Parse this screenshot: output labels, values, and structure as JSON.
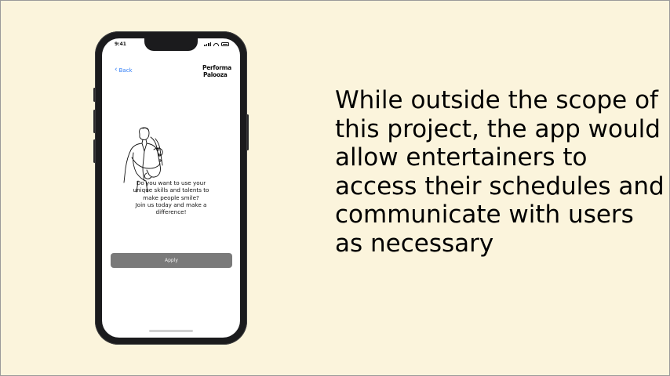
{
  "phone": {
    "status_time": "9:41",
    "back_label": "Back",
    "logo_line1": "Performa",
    "logo_line2": "Palooza",
    "prompt_lines": [
      "Do you want to use your",
      "unique skills and talents to",
      "make people smile?",
      "Join us today and make a",
      "difference!"
    ],
    "apply_label": "Apply"
  },
  "caption": {
    "text": "While outside the scope of this project, the app would allow entertainers to access their schedules and communicate with users as necessary"
  },
  "colors": {
    "background": "#fbf4dc",
    "link_blue": "#2f7cf6",
    "button_gray": "#7a7a7a"
  }
}
